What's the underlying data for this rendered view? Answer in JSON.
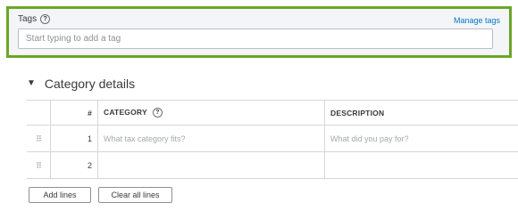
{
  "tags": {
    "label": "Tags",
    "help_glyph": "?",
    "manage_link": "Manage tags",
    "input_placeholder": "Start typing to add a tag",
    "accent_border": "#6aa626"
  },
  "category_details": {
    "caret_glyph": "▼",
    "title": "Category details",
    "columns": {
      "number": "#",
      "category": "CATEGORY",
      "category_help": "?",
      "description": "DESCRIPTION"
    },
    "rows": [
      {
        "number": "1",
        "category_placeholder": "What tax category fits?",
        "description_placeholder": "What did you pay for?"
      },
      {
        "number": "2",
        "category_placeholder": "",
        "description_placeholder": ""
      }
    ],
    "drag_glyph": "⠿"
  },
  "buttons": {
    "add_lines": "Add lines",
    "clear_all_lines": "Clear all lines"
  }
}
